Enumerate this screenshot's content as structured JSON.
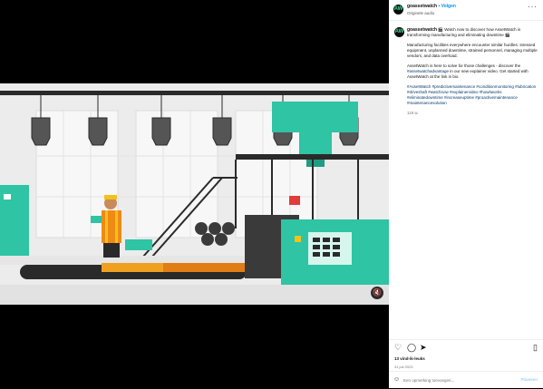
{
  "post": {
    "username": "goassetwatch",
    "separator": "•",
    "follow_label": "Volgen",
    "audio": "Originele audio",
    "more_label": "···",
    "caption": {
      "username": "goassetwatch",
      "p1": "🎬 Watch now to discover how AssetWatch is transforming manufacturing and eliminating downtime 🎬",
      "p2": "Manufacturing facilities everywhere encounter similar hurdles: stressed equipment, unplanned downtime, strained personnel, managing multiple vendors, and data overload.",
      "p3a": "AssetWatch is here to solve for those challenges - discover the ",
      "p3tag": "#assetwatchadvantage",
      "p3b": " in our new explainer video. Get started with AssetWatch at the link in bio.",
      "hashtags": "#AssetWatch #predictivemaintenance #conditionmonitoring #lubrication #driveshaft #watchnow #explainervideo #howitworks #eliminatedowntime #increaseuptime #proactivemaintenance #maintenancesolution",
      "age": "118 w."
    },
    "icons": {
      "like": "heart-icon",
      "comment": "comment-icon",
      "share": "share-icon",
      "save": "bookmark-icon",
      "emoji": "emoji-icon",
      "mute": "mute-icon"
    },
    "likes": "13 vind-ik-leuks",
    "date": "31 juli 2023",
    "comment_placeholder": "Een opmerking toevoegen...",
    "post_label": "Plaatsen"
  },
  "colors": {
    "brand": "#0b0b0b",
    "brand_accent": "#3ee09a",
    "machine_teal": "#2ec4a4",
    "link": "#00376b",
    "follow": "#0095f6"
  }
}
